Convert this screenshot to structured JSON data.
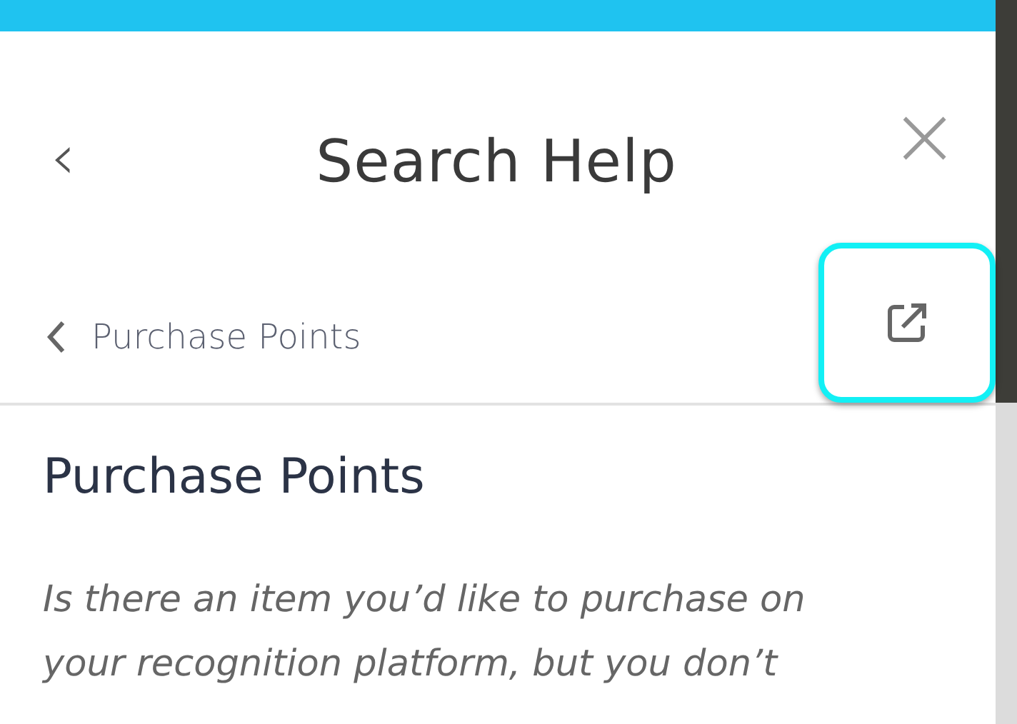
{
  "header": {
    "back": "‹",
    "title": "Search Help",
    "close": "×"
  },
  "breadcrumb": {
    "label": "Purchase Points",
    "open_external": {
      "focused": true
    }
  },
  "article": {
    "title": "Purchase Points",
    "intro": "Is there an item you’d like to purchase on your recognition platform, but you don’t"
  }
}
